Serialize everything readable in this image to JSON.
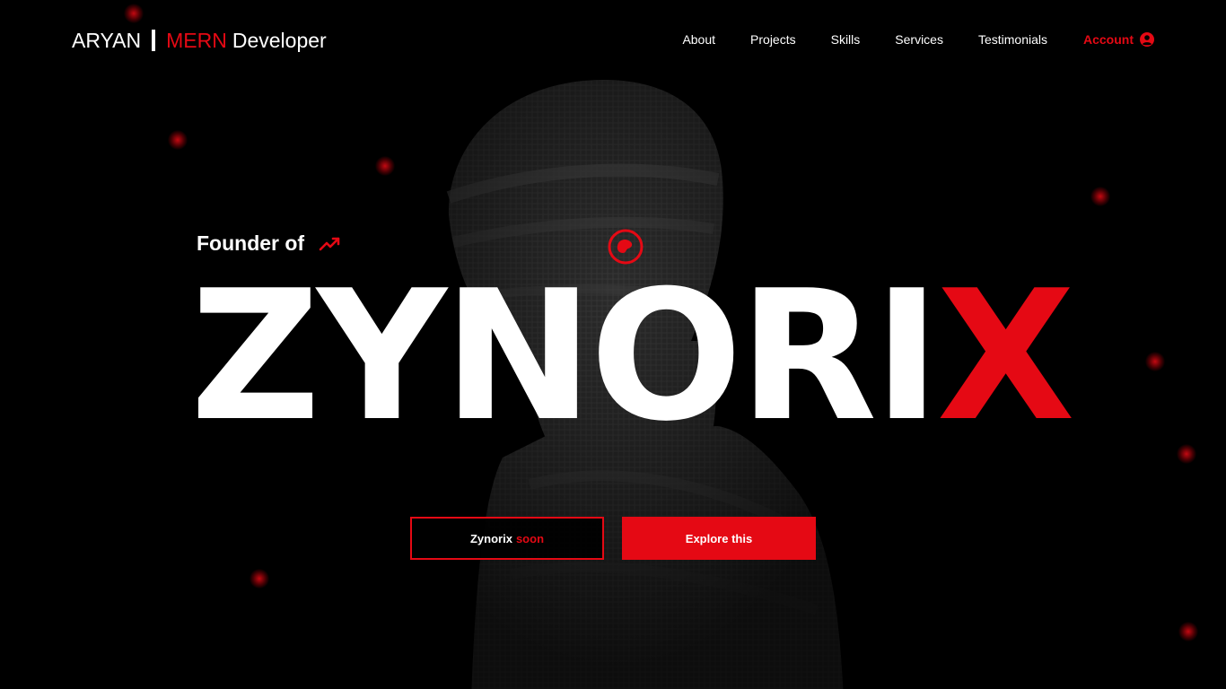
{
  "nav": {
    "brand_name": "ARYAN",
    "brand_accent": "MERN",
    "brand_role": "Developer",
    "items": [
      {
        "label": "About"
      },
      {
        "label": "Projects"
      },
      {
        "label": "Skills"
      },
      {
        "label": "Services"
      },
      {
        "label": "Testimonials"
      }
    ],
    "account_label": "Account",
    "account_icon": "user-circle-icon"
  },
  "hero": {
    "eyebrow": "Founder of",
    "eyebrow_icon": "trending-up-icon",
    "headline_main": "ZYNORI",
    "headline_accent": "X",
    "target_icon": "target-icon",
    "primary_button_label": "Zynorix",
    "primary_button_suffix": "soon",
    "secondary_button_label": "Explore this"
  },
  "colors": {
    "background": "#000000",
    "accent": "#e50914",
    "text": "#ffffff"
  }
}
